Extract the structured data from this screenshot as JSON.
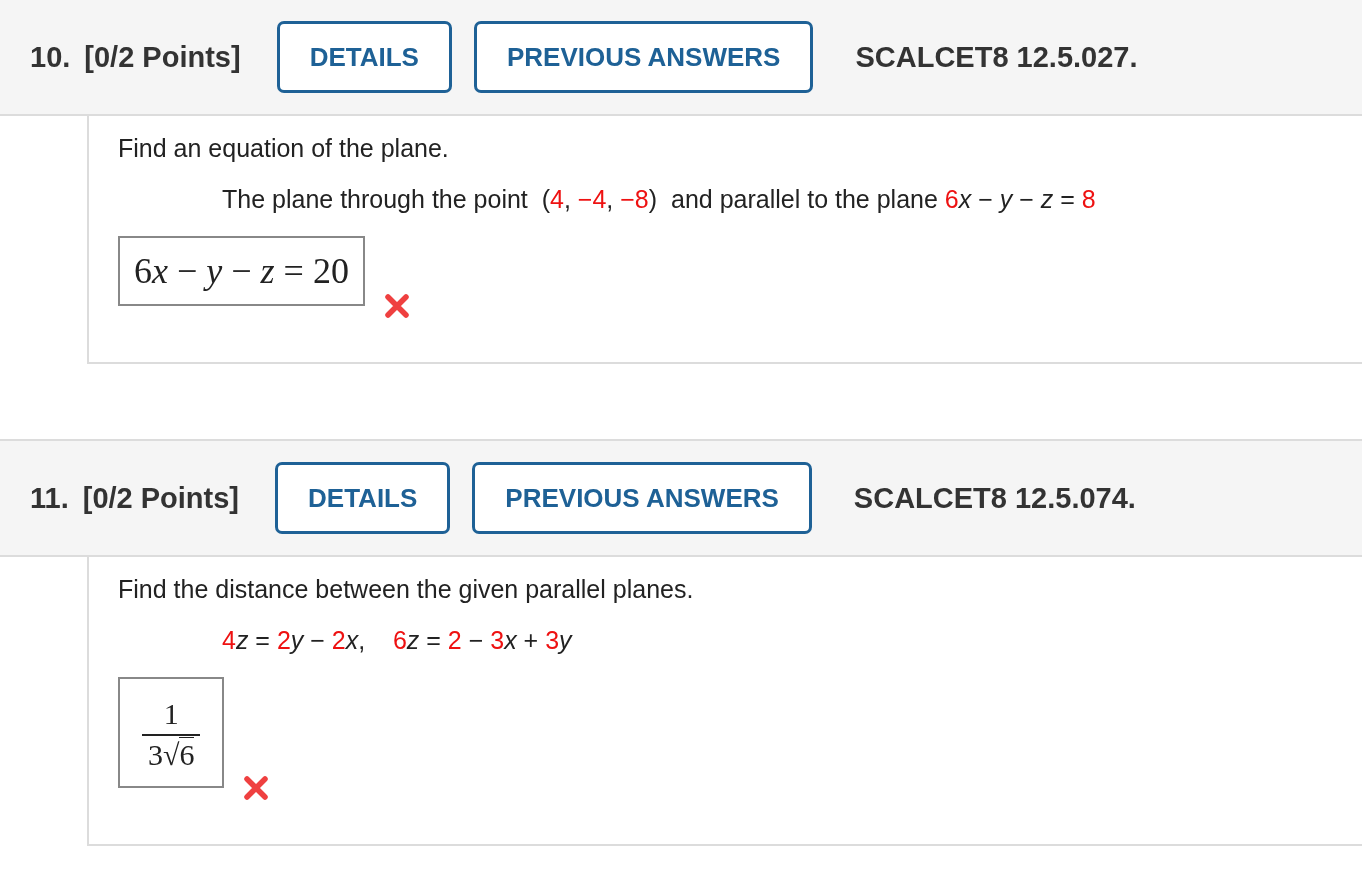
{
  "questions": [
    {
      "number": "10.",
      "points": "[0/2 Points]",
      "buttons": [
        "DETAILS",
        "PREVIOUS ANSWERS"
      ],
      "code": "SCALCET8 12.5.027.",
      "prompt": "Find an equation of the plane.",
      "statement": [
        {
          "text": "The plane through the point  ",
          "emphasis": false
        },
        {
          "text": "(",
          "emphasis": false
        },
        {
          "text": "4",
          "emphasis": true
        },
        {
          "text": ", ",
          "emphasis": false
        },
        {
          "text": "−4",
          "emphasis": true
        },
        {
          "text": ", ",
          "emphasis": false
        },
        {
          "text": "−8",
          "emphasis": true
        },
        {
          "text": ")  and parallel to the plane ",
          "emphasis": false
        },
        {
          "text": "6",
          "emphasis": true
        },
        {
          "text": "*x* − *y* − *z* = ",
          "emphasis": false
        },
        {
          "text": "8",
          "emphasis": true
        }
      ],
      "answer": {
        "kind": "equation",
        "parts": [
          {
            "text": "6",
            "italic": false
          },
          {
            "text": "x",
            "italic": true
          },
          {
            "text": " − ",
            "italic": false
          },
          {
            "text": "y",
            "italic": true
          },
          {
            "text": " − ",
            "italic": false
          },
          {
            "text": "z",
            "italic": true
          },
          {
            "text": " = 20",
            "italic": false
          }
        ]
      },
      "correct": false
    },
    {
      "number": "11.",
      "points": "[0/2 Points]",
      "buttons": [
        "DETAILS",
        "PREVIOUS ANSWERS"
      ],
      "code": "SCALCET8 12.5.074.",
      "prompt": "Find the distance between the given parallel planes.",
      "statement": [
        {
          "text": "4",
          "emphasis": true
        },
        {
          "text": "*z* = ",
          "emphasis": false
        },
        {
          "text": "2",
          "emphasis": true
        },
        {
          "text": "*y* − ",
          "emphasis": false
        },
        {
          "text": "2",
          "emphasis": true
        },
        {
          "text": "*x*,    ",
          "emphasis": false
        },
        {
          "text": "6",
          "emphasis": true
        },
        {
          "text": "*z* = ",
          "emphasis": false
        },
        {
          "text": "2",
          "emphasis": true
        },
        {
          "text": " − ",
          "emphasis": false
        },
        {
          "text": "3",
          "emphasis": true
        },
        {
          "text": "*x* + ",
          "emphasis": false
        },
        {
          "text": "3",
          "emphasis": true
        },
        {
          "text": "*y*",
          "emphasis": false
        }
      ],
      "answer": {
        "kind": "fraction",
        "numerator": "1",
        "coefficient": "3",
        "sign": "√",
        "radicand": "6"
      },
      "correct": false
    }
  ]
}
